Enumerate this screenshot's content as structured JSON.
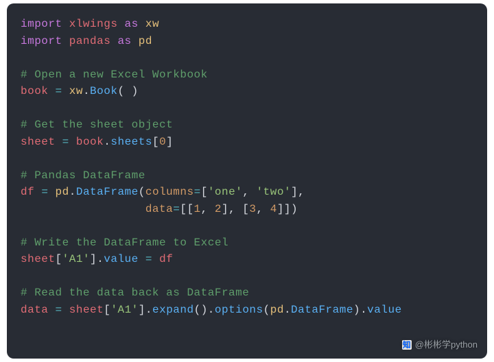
{
  "code": {
    "l1": {
      "kw1": "import",
      "mod": "xlwings",
      "kw2": "as",
      "alias": "xw"
    },
    "l2": {
      "kw1": "import",
      "mod": "pandas",
      "kw2": "as",
      "alias": "pd"
    },
    "l4": {
      "comment": "# Open a new Excel Workbook"
    },
    "l5": {
      "lhs": "book",
      "eq": "=",
      "obj": "xw",
      "dot": ".",
      "call": "Book",
      "paren": "(",
      "space": " ",
      "close": ")"
    },
    "l7": {
      "comment": "# Get the sheet object"
    },
    "l8": {
      "lhs": "sheet",
      "eq": "=",
      "obj": "book",
      "dot": ".",
      "attr": "sheets",
      "lbr": "[",
      "idx": "0",
      "rbr": "]"
    },
    "l10": {
      "comment": "# Pandas DataFrame"
    },
    "l11": {
      "lhs": "df",
      "eq": "=",
      "obj": "pd",
      "dot": ".",
      "call": "DataFrame",
      "open": "(",
      "kw": "columns",
      "eq2": "=",
      "lbr": "[",
      "s1": "'one'",
      "comma": ",",
      "s2": "'two'",
      "rbr": "]",
      "comma2": ","
    },
    "l12": {
      "indent": "                  ",
      "kw": "data",
      "eq": "=",
      "open": "[[",
      "n1": "1",
      "c1": ",",
      "n2": "2",
      "mid": "], [",
      "n3": "3",
      "c2": ",",
      "n4": "4",
      "close": "]])"
    },
    "l14": {
      "comment": "# Write the DataFrame to Excel"
    },
    "l15": {
      "obj": "sheet",
      "lbr": "[",
      "s": "'A1'",
      "rbr": "]",
      "dot": ".",
      "attr": "value",
      "eq": "=",
      "rhs": "df"
    },
    "l17": {
      "comment": "# Read the data back as DataFrame"
    },
    "l18": {
      "lhs": "data",
      "eq": "=",
      "obj": "sheet",
      "lbr": "[",
      "s": "'A1'",
      "rbr": "]",
      "dot": ".",
      "m1": "expand",
      "p1": "().",
      "m2": "options",
      "p2": "(",
      "obj2": "pd",
      "dot2": ".",
      "cls": "DataFrame",
      "p3": ").",
      "attr": "value"
    }
  },
  "watermark": {
    "logo": "知",
    "text": "@彬彬学python"
  }
}
